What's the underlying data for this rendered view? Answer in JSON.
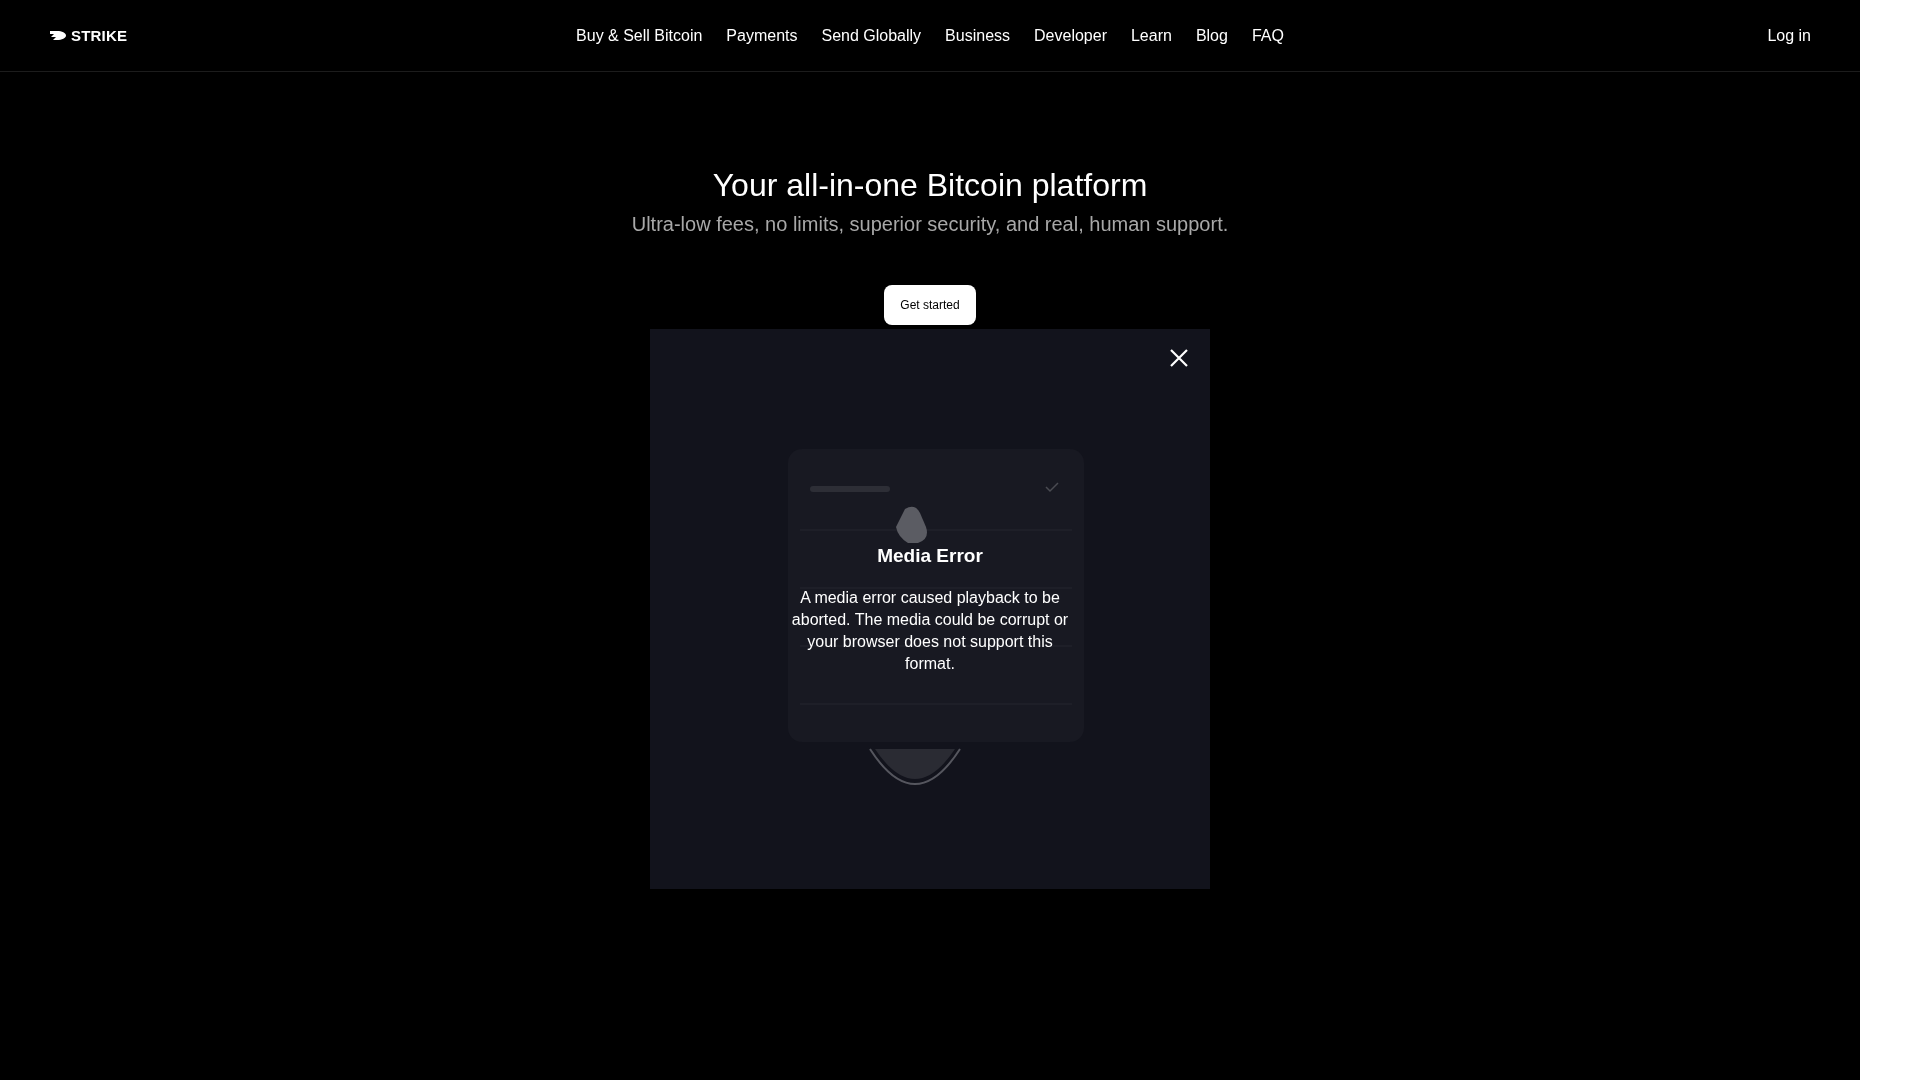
{
  "header": {
    "logo": "STRIKE",
    "nav": [
      "Buy & Sell Bitcoin",
      "Payments",
      "Send Globally",
      "Business",
      "Developer",
      "Learn",
      "Blog",
      "FAQ"
    ],
    "login": "Log in"
  },
  "hero": {
    "title": "Your all-in-one Bitcoin platform",
    "subtitle": "Ultra-low fees, no limits, superior security, and real, human support.",
    "cta": "Get started"
  },
  "video": {
    "kind": "picture",
    "error_title": "Media Error",
    "error_message": "A media error caused playback to be aborted. The media could be corrupt or your browser does not support this format."
  }
}
